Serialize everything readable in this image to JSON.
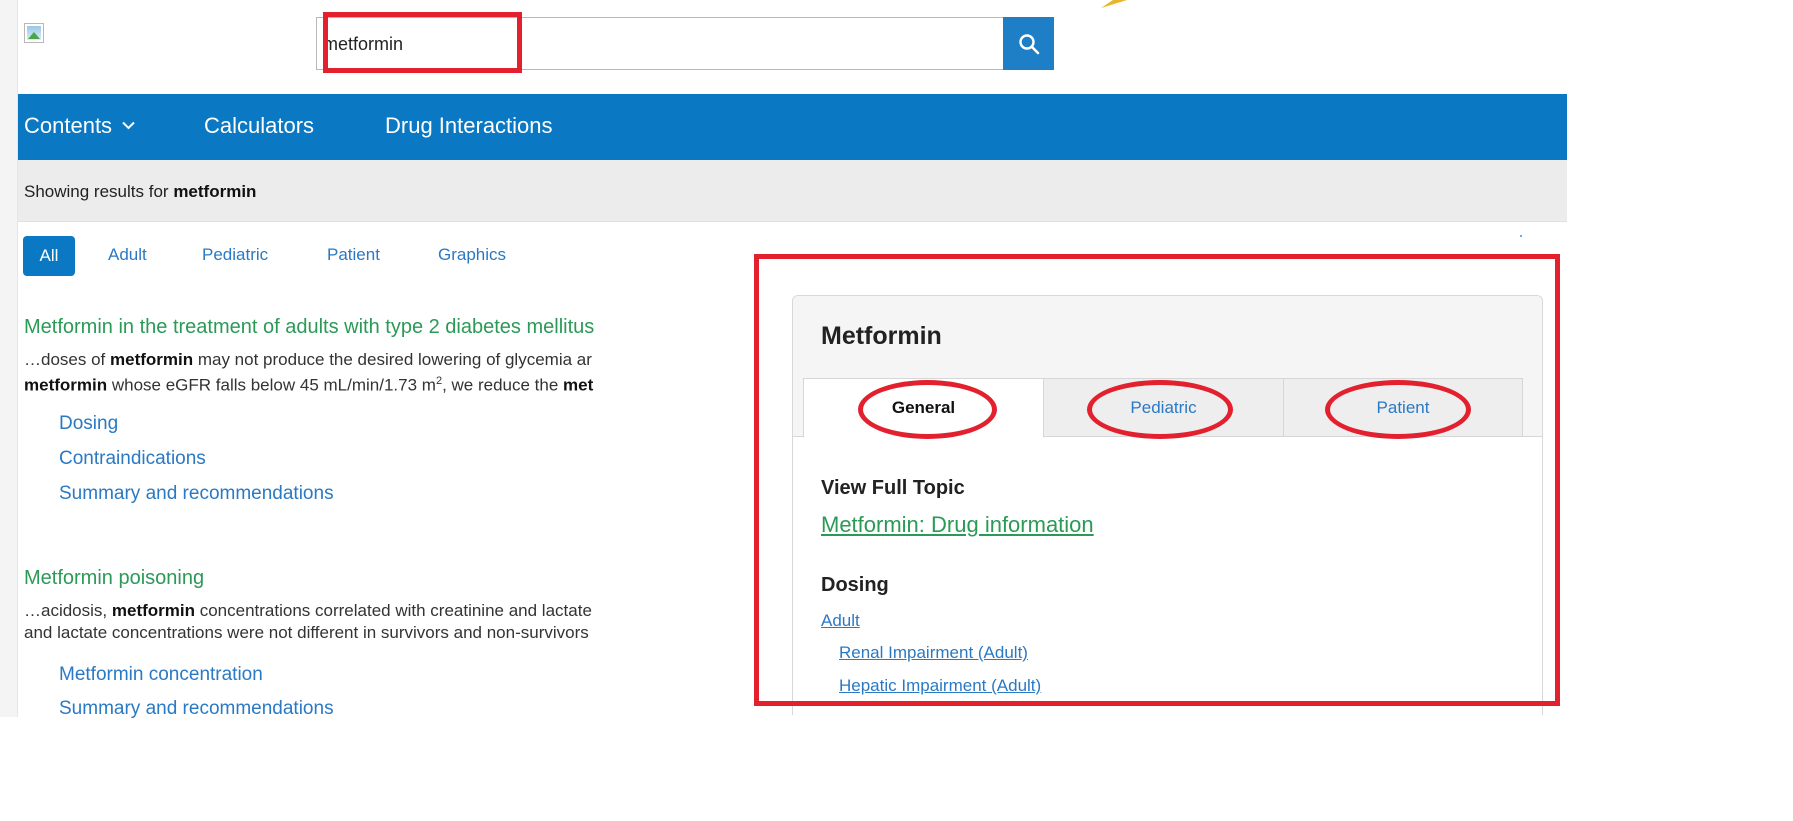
{
  "search": {
    "value": "metformin"
  },
  "nav": {
    "contents": "Contents",
    "calculators": "Calculators",
    "drug_interactions": "Drug Interactions"
  },
  "showing": {
    "prefix": "Showing results for",
    "term": "metformin"
  },
  "filters": [
    "All",
    "Adult",
    "Pediatric",
    "Patient",
    "Graphics"
  ],
  "results": [
    {
      "title": "Metformin in the treatment of adults with type 2 diabetes mellitus",
      "line1": [
        "…doses of ",
        "metformin",
        " may not produce the desired lowering of glycemia ar"
      ],
      "line2": [
        "metformin",
        " whose eGFR falls below 45 mL/min/1.73 m",
        "2",
        ", we reduce the ",
        "met"
      ],
      "links": [
        "Dosing",
        "Contraindications",
        "Summary and recommendations"
      ]
    },
    {
      "title": "Metformin poisoning",
      "line1": [
        "…acidosis, ",
        "metformin",
        " concentrations correlated with creatinine and lactate"
      ],
      "line2": [
        "and lactate concentrations were not different in survivors and non-survivors"
      ],
      "links": [
        "Metformin concentration",
        "Summary and recommendations"
      ]
    }
  ],
  "panel": {
    "title": "Metformin",
    "tabs": [
      "General",
      "Pediatric",
      "Patient"
    ],
    "view_full_topic": "View Full Topic",
    "drug_info_link": "Metformin: Drug information",
    "dosing": "Dosing",
    "adult": "Adult",
    "renal": "Renal Impairment (Adult)",
    "hepatic": "Hepatic Impairment (Adult)"
  },
  "colors": {
    "nav_blue": "#0a78c2",
    "link_blue": "#2a79c4",
    "result_green": "#2b9a57",
    "annotation_red": "#e3202d"
  },
  "icons": {
    "search": "search-icon",
    "chevron": "chevron-down-icon",
    "logo": "broken-image-icon"
  }
}
